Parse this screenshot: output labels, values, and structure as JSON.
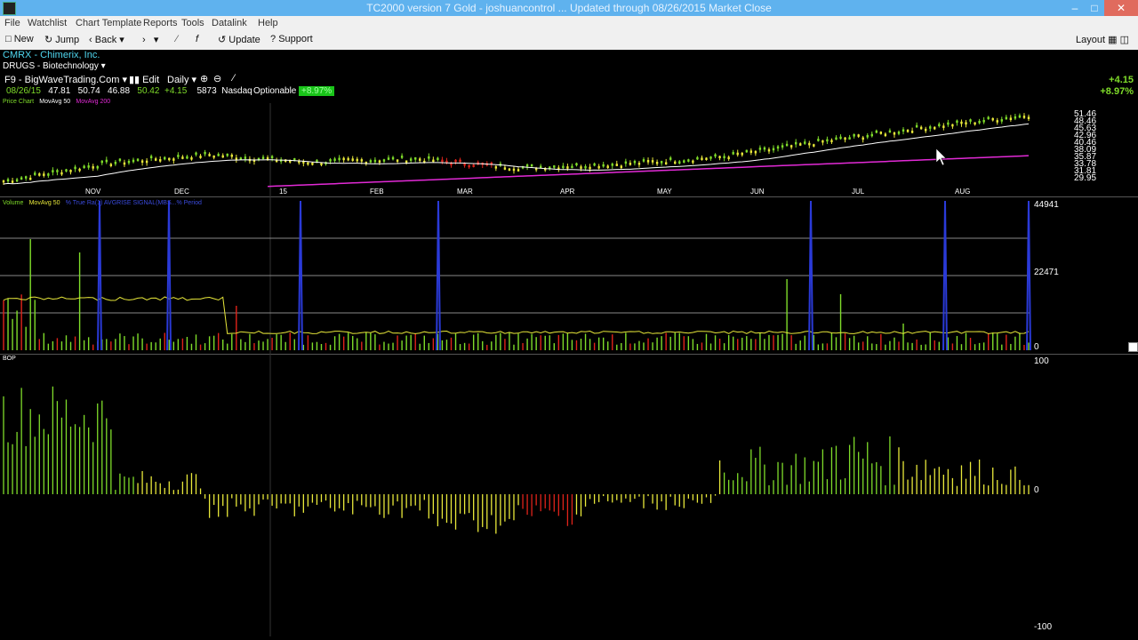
{
  "window": {
    "title": "TC2000 version 7 Gold - joshuancontrol ... Updated through 08/26/2015 Market Close"
  },
  "menu": [
    "File",
    "Watchlist",
    "Chart Template",
    "Reports",
    "Tools",
    "Datalink",
    "Help"
  ],
  "toolbar": {
    "new": "New",
    "jump": "Jump",
    "back": "Back",
    "update": "Update",
    "support": "Support",
    "layout": "Layout"
  },
  "chart": {
    "symbol": "CMRX - Chimerix, Inc.",
    "industry": "DRUGS - Biotechnology",
    "template": "F9 - BigWaveTrading.Com",
    "edit": "Edit",
    "period": "Daily",
    "date": "08/26/15",
    "open": "47.81",
    "high": "50.74",
    "low": "46.88",
    "close": "50.42",
    "change": "+4.15",
    "volume": "5873",
    "exchange": "Nasdaq",
    "optionable": "Optionable",
    "pct_badge": "+8.97%",
    "price_label": "Price Chart",
    "ma50_label": "MovAvg 50",
    "ma200_label": "MovAvg 200",
    "right_change": "+4.15",
    "right_pct": "+8.97%",
    "volume_label": "Volume",
    "vol_ma_label": "MovAvg 50",
    "vol_extra": "% True Ra(1) AVGRISE SIGNAL(MBS...% Period",
    "bop_label": "BOP"
  },
  "colors": {
    "up": "#7fdc2a",
    "neutral": "#e8e83a",
    "down": "#e0231a",
    "ma50": "#ffffff",
    "ma200": "#e22ad6",
    "spike": "#2a3ad8"
  },
  "chart_data": {
    "type": "line",
    "price_axis_ticks": [
      "51.46",
      "48.46",
      "45.63",
      "42.96",
      "40.46",
      "38.09",
      "35.87",
      "33.78",
      "31.81",
      "29.95"
    ],
    "x_ticks": [
      "NOV",
      "DEC",
      "15",
      "FEB",
      "MAR",
      "APR",
      "MAY",
      "JUN",
      "JUL",
      "AUG"
    ],
    "volume_axis": [
      "44941",
      "22471",
      "0"
    ],
    "bop_axis": [
      "100",
      "0",
      "-100"
    ],
    "price_series": [
      {
        "month": "NOV",
        "close": 30.5
      },
      {
        "month": "DEC",
        "close": 35.9
      },
      {
        "month": "15",
        "close": 38.5
      },
      {
        "month": "FEB",
        "close": 36.2
      },
      {
        "month": "MAR",
        "close": 37.3
      },
      {
        "month": "APR",
        "close": 34.6
      },
      {
        "month": "MAY",
        "close": 35.6
      },
      {
        "month": "JUN",
        "close": 37.8
      },
      {
        "month": "JUL",
        "close": 42.5
      },
      {
        "month": "AUG",
        "close": 46.8
      },
      {
        "month": "Aug 26",
        "close": 50.42
      }
    ]
  }
}
